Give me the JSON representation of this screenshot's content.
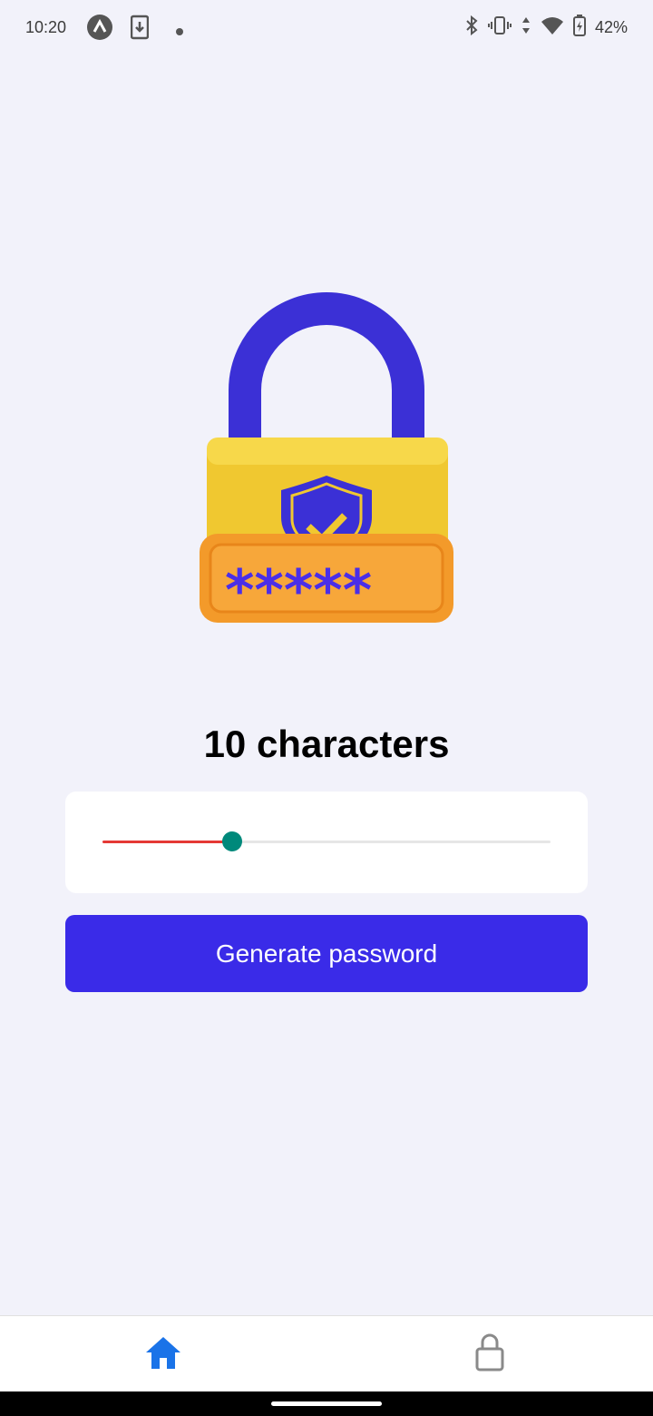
{
  "status_bar": {
    "time": "10:20",
    "battery": "42%",
    "icons": [
      "app-a-icon",
      "download-icon",
      "dot-icon",
      "bluetooth-icon",
      "vibrate-icon",
      "data-arrows-icon",
      "wifi-icon",
      "battery-charging-icon"
    ]
  },
  "main": {
    "illustration": "padlock-password-icon",
    "length_label": "10 characters",
    "slider": {
      "value": 10,
      "fraction": 0.29
    },
    "generate_label": "Generate password"
  },
  "tab_bar": {
    "tabs": [
      {
        "icon": "home-icon",
        "active": true
      },
      {
        "icon": "lock-icon",
        "active": false
      }
    ]
  },
  "colors": {
    "accent": "#3a2be8",
    "active_tab": "#1a73e8",
    "slider_fill": "#e53935",
    "slider_thumb": "#00897b"
  }
}
